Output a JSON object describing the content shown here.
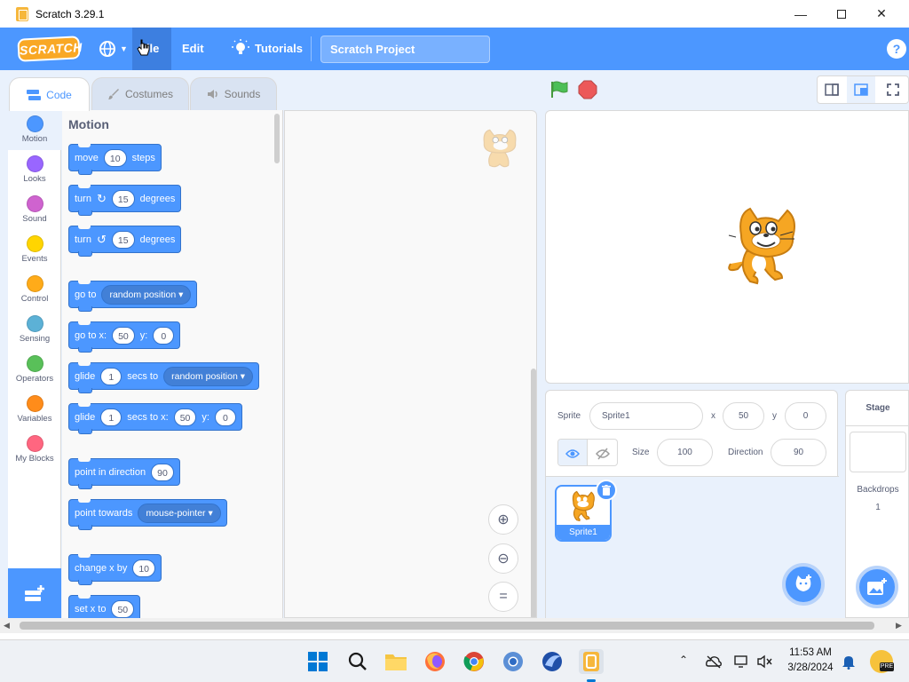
{
  "window": {
    "title": "Scratch 3.29.1",
    "controls": [
      "minimize-icon",
      "maximize-icon",
      "close-icon"
    ]
  },
  "menubar": {
    "logo": "SCRATCH",
    "file": "File",
    "edit": "Edit",
    "tutorials": "Tutorials",
    "project_title": "Scratch Project",
    "help": "?"
  },
  "tabs": [
    {
      "label": "Code",
      "active": true
    },
    {
      "label": "Costumes",
      "active": false
    },
    {
      "label": "Sounds",
      "active": false
    }
  ],
  "categories": [
    {
      "label": "Motion",
      "color": "#4c97ff"
    },
    {
      "label": "Looks",
      "color": "#9966ff"
    },
    {
      "label": "Sound",
      "color": "#cf63cf"
    },
    {
      "label": "Events",
      "color": "#ffd500"
    },
    {
      "label": "Control",
      "color": "#ffab19"
    },
    {
      "label": "Sensing",
      "color": "#5cb1d6"
    },
    {
      "label": "Operators",
      "color": "#59c059"
    },
    {
      "label": "Variables",
      "color": "#ff8c1a"
    },
    {
      "label": "My Blocks",
      "color": "#ff6680"
    }
  ],
  "palette": {
    "heading": "Motion",
    "blocks": {
      "move": {
        "a": "move",
        "v": "10",
        "b": "steps"
      },
      "turn_right": {
        "a": "turn",
        "v": "15",
        "b": "degrees"
      },
      "turn_left": {
        "a": "turn",
        "v": "15",
        "b": "degrees"
      },
      "goto": {
        "a": "go to",
        "dd": "random position"
      },
      "goto_xy": {
        "a": "go to x:",
        "x": "50",
        "b": "y:",
        "y": "0"
      },
      "glide_to": {
        "a": "glide",
        "v": "1",
        "b": "secs to",
        "dd": "random position"
      },
      "glide_xy": {
        "a": "glide",
        "v": "1",
        "b": "secs to x:",
        "x": "50",
        "c": "y:",
        "y": "0"
      },
      "point_dir": {
        "a": "point in direction",
        "v": "90"
      },
      "point_towards": {
        "a": "point towards",
        "dd": "mouse-pointer"
      },
      "change_x": {
        "a": "change x by",
        "v": "10"
      },
      "set_x": {
        "a": "set x to",
        "v": "50"
      }
    }
  },
  "sprite_info": {
    "sprite_label": "Sprite",
    "sprite_name": "Sprite1",
    "x_label": "x",
    "x": "50",
    "y_label": "y",
    "y": "0",
    "size_label": "Size",
    "size": "100",
    "direction_label": "Direction",
    "direction": "90"
  },
  "sprite_list": [
    {
      "name": "Sprite1",
      "selected": true
    }
  ],
  "stage_panel": {
    "title": "Stage",
    "backdrops_label": "Backdrops",
    "backdrops_count": "1"
  },
  "taskbar": {
    "time": "11:53 AM",
    "date": "3/28/2024"
  },
  "colors": {
    "brand_blue": "#4c97ff",
    "motion_dark": "#3373cc",
    "green_flag": "#0fbd8c",
    "stop": "#ec5959"
  }
}
